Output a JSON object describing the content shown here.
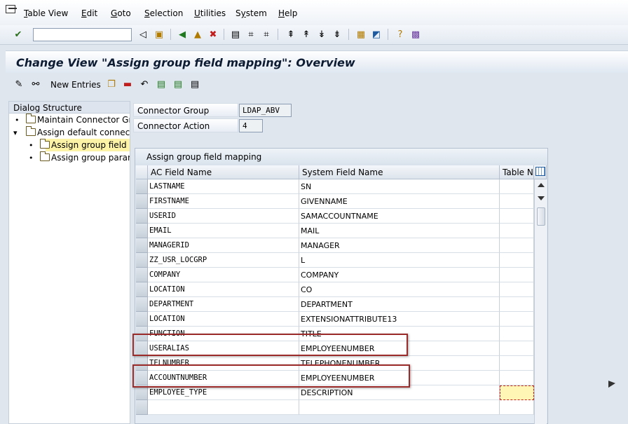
{
  "menu": [
    "Table View",
    "Edit",
    "Goto",
    "Selection",
    "Utilities",
    "System",
    "Help"
  ],
  "menu_hotkeys": [
    "T",
    "E",
    "G",
    "S",
    "U",
    "y",
    "H"
  ],
  "toolbar": {
    "command_field_value": ""
  },
  "title": "Change View \"Assign group field mapping\": Overview",
  "app_toolbar": {
    "new_entries_label": "New Entries"
  },
  "dialog_structure": {
    "header": "Dialog Structure",
    "items": [
      {
        "label": "Maintain Connector Grou",
        "level": 0,
        "marker": "•"
      },
      {
        "label": "Assign default connecto",
        "level": 0,
        "marker": "▾"
      },
      {
        "label": "Assign group field ma",
        "level": 1,
        "marker": "•",
        "selected": true
      },
      {
        "label": "Assign group parame",
        "level": 1,
        "marker": "•"
      }
    ]
  },
  "header_fields": {
    "connector_group_label": "Connector Group",
    "connector_group_value": "LDAP_ABV",
    "connector_action_label": "Connector Action",
    "connector_action_value": "4"
  },
  "table": {
    "title": "Assign group field mapping",
    "columns": [
      "AC Field Name",
      "System Field Name",
      "Table Na"
    ],
    "rows": [
      [
        "LASTNAME",
        "SN",
        ""
      ],
      [
        "FIRSTNAME",
        "GIVENNAME",
        ""
      ],
      [
        "USERID",
        "SAMACCOUNTNAME",
        ""
      ],
      [
        "EMAIL",
        "MAIL",
        ""
      ],
      [
        "MANAGERID",
        "MANAGER",
        ""
      ],
      [
        "ZZ_USR_LOCGRP",
        "L",
        ""
      ],
      [
        "COMPANY",
        "COMPANY",
        ""
      ],
      [
        "LOCATION",
        "CO",
        ""
      ],
      [
        "DEPARTMENT",
        "DEPARTMENT",
        ""
      ],
      [
        "LOCATION",
        "EXTENSIONATTRIBUTE13",
        ""
      ],
      [
        "FUNCTION",
        "TITLE",
        ""
      ],
      [
        "USERALIAS",
        "EMPLOYEENUMBER",
        ""
      ],
      [
        "TELNUMBER",
        "TELEPHONENUMBER",
        ""
      ],
      [
        "ACCOUNTNUMBER",
        "EMPLOYEENUMBER",
        ""
      ],
      [
        "EMPLOYEE_TYPE",
        "DESCRIPTION",
        ""
      ],
      [
        "",
        "",
        ""
      ],
      [
        "",
        "",
        ""
      ]
    ]
  },
  "colors": {
    "highlight_box": "#9b2b2b",
    "selected_tree": "#fdf3a6",
    "focus_cell": "#fff6b5"
  }
}
